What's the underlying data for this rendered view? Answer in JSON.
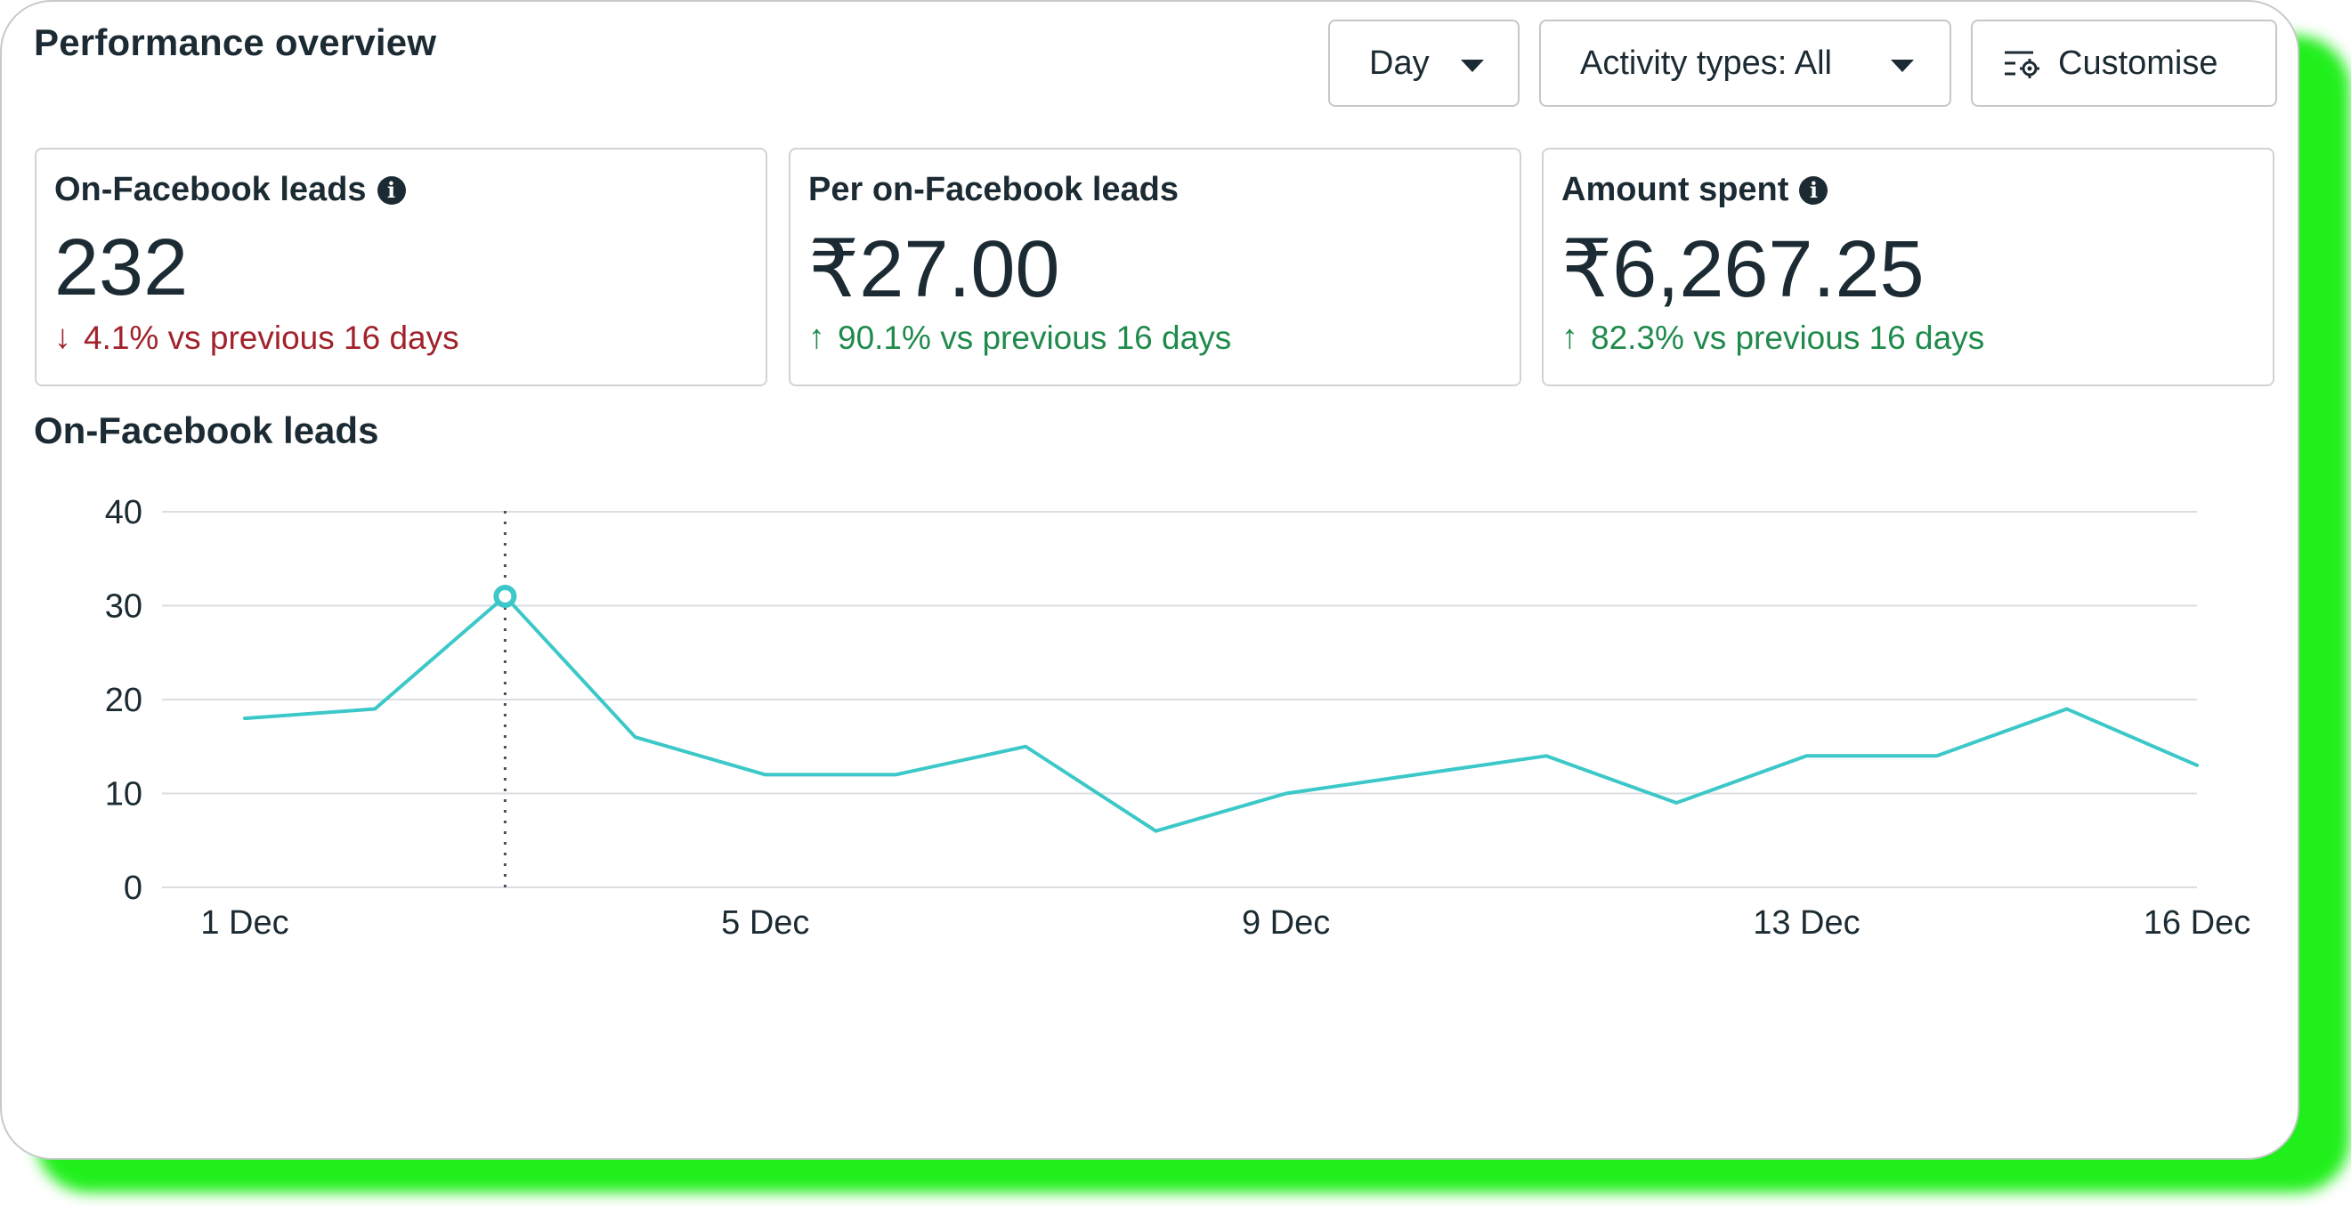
{
  "header": {
    "title": "Performance overview",
    "day_label": "Day",
    "activity_label": "Activity types: All",
    "customise_label": "Customise"
  },
  "metrics": [
    {
      "label": "On-Facebook leads",
      "has_info": true,
      "value": "232",
      "change": "4.1% vs previous 16 days",
      "direction": "down",
      "color": "#a1222b"
    },
    {
      "label": "Per on-Facebook leads",
      "has_info": false,
      "value": "₹27.00",
      "change": "90.1% vs previous 16 days",
      "direction": "up",
      "color": "#1f8a4c"
    },
    {
      "label": "Amount spent",
      "has_info": true,
      "value": "₹6,267.25",
      "change": "82.3% vs previous 16 days",
      "direction": "up",
      "color": "#1f8a4c"
    }
  ],
  "chart_data": {
    "type": "line",
    "title": "On-Facebook leads",
    "x": [
      "1 Dec",
      "2 Dec",
      "3 Dec",
      "4 Dec",
      "5 Dec",
      "6 Dec",
      "7 Dec",
      "8 Dec",
      "9 Dec",
      "10 Dec",
      "11 Dec",
      "12 Dec",
      "13 Dec",
      "14 Dec",
      "15 Dec",
      "16 Dec"
    ],
    "x_tick_labels": [
      "1 Dec",
      "5 Dec",
      "9 Dec",
      "13 Dec",
      "16 Dec"
    ],
    "y_ticks": [
      0,
      10,
      20,
      30,
      40
    ],
    "ylim": [
      0,
      40
    ],
    "series": [
      {
        "values": [
          18,
          19,
          31,
          16,
          12,
          12,
          15,
          6,
          10,
          12,
          14,
          9,
          14,
          14,
          19,
          13
        ],
        "color": "#3cc8c8"
      }
    ],
    "highlight_index": 2,
    "grid": true,
    "grid_color": "#dadde1"
  },
  "icons": {
    "info": "info-icon",
    "down": "arrow-down-icon",
    "up": "arrow-up-icon",
    "caret": "caret-down-icon",
    "customise": "settings-sliders-icon"
  },
  "colors": {
    "accent_glow": "#21ef1c",
    "text": "#1c2b33",
    "border": "#c7c9cc"
  }
}
